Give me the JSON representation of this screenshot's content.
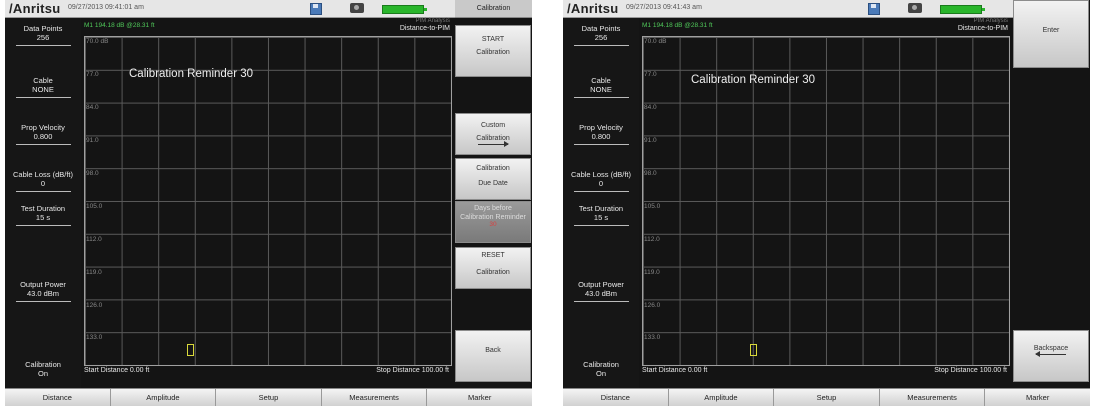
{
  "colors": {
    "trace_label": "#50c95a",
    "battery": "#29b52b",
    "cursor": "#d9d93a",
    "red_value": "#d84040"
  },
  "brand": "/Anritsu",
  "left_params": [
    {
      "label": "Data Points",
      "value": "256"
    },
    {
      "label": "Cable",
      "value": "NONE"
    },
    {
      "label": "Prop Velocity",
      "value": "0.800"
    },
    {
      "label": "Cable Loss (dB/ft)",
      "value": "0"
    },
    {
      "label": "Test Duration",
      "value": "15 s"
    },
    {
      "label": "Output Power",
      "value": "43.0 dBm"
    },
    {
      "label": "Calibration",
      "value": "On"
    }
  ],
  "y_labels": [
    "70.0 dB",
    "77.0",
    "84.0",
    "91.0",
    "98.0",
    "105.0",
    "112.0",
    "119.0",
    "126.0",
    "133.0"
  ],
  "bottom_tabs": [
    "Distance",
    "Amplitude",
    "Setup",
    "Measurements",
    "Marker"
  ],
  "screen1": {
    "timestamp": "09/27/2013 09:41:01 am",
    "trace_info": "M1 194.18 dB @28.31 ft",
    "mode_small": "PIM Analysis",
    "mode": "Distance-to-PIM",
    "reminder": "Calibration Reminder 30",
    "start": "Start Distance 0.00 ft",
    "stop": "Stop Distance 100.00 ft",
    "menu_title": "Calibration",
    "soft": {
      "start_l1": "START",
      "start_l2": "Calibration",
      "custom_l1": "Custom",
      "custom_l2": "Calibration",
      "due_l1": "Calibration",
      "due_l2": "Due Date",
      "days_l1": "Days before",
      "days_l2": "Calibration Reminder",
      "days_val": "30",
      "reset_l1": "RESET",
      "reset_l2": "Calibration",
      "back": "Back"
    }
  },
  "screen2": {
    "timestamp": "09/27/2013 09:41:43 am",
    "trace_info": "M1 194.18 dB @28.31 ft",
    "mode_small": "PIM Analysis",
    "mode": "Distance-to-PIM",
    "reminder": "Calibration Reminder 30",
    "start": "Start Distance 0.00 ft",
    "stop": "Stop Distance 100.00 ft",
    "soft": {
      "enter": "Enter",
      "backspace": "Backspace"
    }
  }
}
